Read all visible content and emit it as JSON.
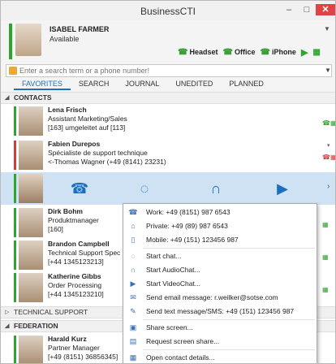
{
  "app": {
    "title": "BusinessCTI"
  },
  "window": {
    "minimize": "–",
    "maximize": "□",
    "close": "✕"
  },
  "user": {
    "name": "ISABEL FARMER",
    "status": "Available"
  },
  "devices": [
    {
      "label": "Headset"
    },
    {
      "label": "Office"
    },
    {
      "label": "iPhone"
    }
  ],
  "search": {
    "placeholder": "Enter a search term or a phone number!"
  },
  "tabs": [
    "FAVORITES",
    "SEARCH",
    "JOURNAL",
    "UNEDITED",
    "PLANNED"
  ],
  "sections": {
    "contacts": "CONTACTS",
    "technical_support": "TECHNICAL SUPPORT",
    "federation": "FEDERATION"
  },
  "contacts": [
    {
      "name": "Lena Frisch",
      "line2": "Assistant Marketing/Sales",
      "line3": "[163] umgeleitet auf [113]"
    },
    {
      "name": "Fabien Durepos",
      "line2": "Spécialiste de support technique",
      "line3": "<-Thomas Wagner (+49 (8141) 23231)"
    },
    {
      "name": "Dirk Bohm",
      "line2": "Produktmanager",
      "line3": "[160]"
    },
    {
      "name": "Brandon Campbell",
      "line2": "Technical Support Spec",
      "line3": "[+44 1345123213]"
    },
    {
      "name": "Katherine Gibbs",
      "line2": "Order Processing",
      "line3": "[+44 1345123210]"
    }
  ],
  "federation_contacts": [
    {
      "name": "Harald Kurz",
      "line2": "Partner Manager",
      "line3": "[+49 (8151) 36856345]"
    }
  ],
  "menu": [
    {
      "icon": "phone-icon",
      "glyph": "☎",
      "label": "Work: +49 (8151) 987 6543"
    },
    {
      "icon": "home-icon",
      "glyph": "⌂",
      "label": "Private: +49 (89) 987 6543"
    },
    {
      "icon": "mobile-icon",
      "glyph": "▯",
      "label": "Mobile: +49 (151) 123456 987"
    },
    {
      "icon": "chat-icon",
      "glyph": "◌",
      "label": "Start chat..."
    },
    {
      "icon": "headset-icon",
      "glyph": "∩",
      "label": "Start AudioChat..."
    },
    {
      "icon": "video-icon",
      "glyph": "▶",
      "label": "Start VideoChat..."
    },
    {
      "icon": "email-icon",
      "glyph": "✉",
      "label": "Send email message: r.weilker@sotse.com"
    },
    {
      "icon": "sms-icon",
      "glyph": "✎",
      "label": "Send text message/SMS: +49 (151) 123456 987"
    },
    {
      "icon": "share-screen-icon",
      "glyph": "▣",
      "label": "Share screen..."
    },
    {
      "icon": "request-screen-icon",
      "glyph": "▤",
      "label": "Request screen share..."
    },
    {
      "icon": "contact-details-icon",
      "glyph": "▦",
      "label": "Open contact details..."
    }
  ]
}
